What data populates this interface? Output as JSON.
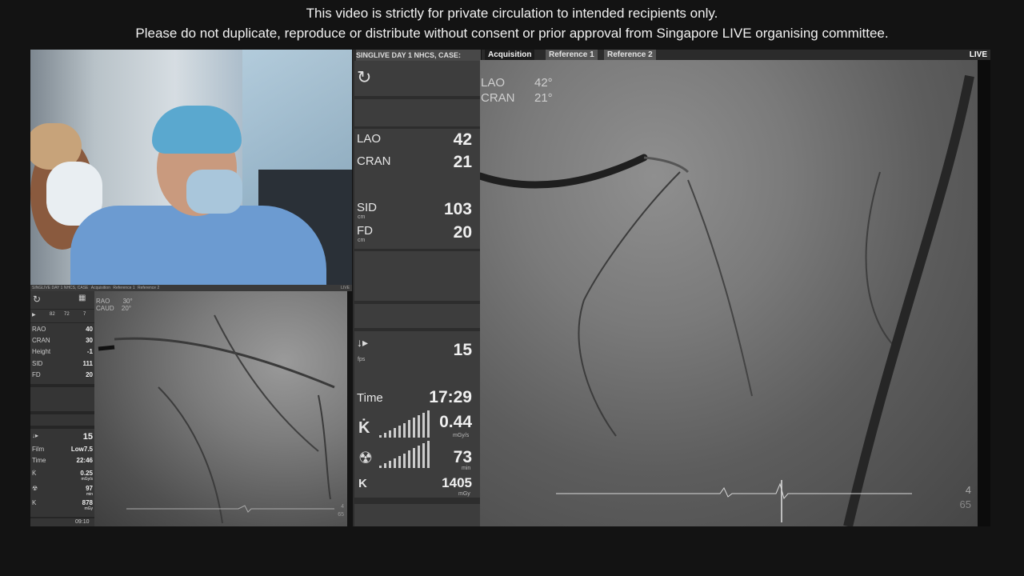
{
  "notice": {
    "line1": "This video is strictly for private circulation to intended recipients only.",
    "line2": "Please do not duplicate, reproduce or distribute without consent or prior approval from Singapore LIVE organising committee."
  },
  "small_panel": {
    "title": "SINGLIVE DAY 1 NHCS, CASE",
    "tabs": [
      "Acquisition",
      "Reference 1",
      "Reference 2"
    ],
    "live": "LIVE",
    "angle_overlay": {
      "rao": "RAO",
      "rao_val": "30°",
      "caud": "CAUD",
      "caud_val": "20°"
    },
    "readouts": [
      {
        "label": "RAO",
        "value": "40"
      },
      {
        "label": "CRAN",
        "value": "30"
      },
      {
        "label": "Height",
        "value": "-1"
      },
      {
        "label": "SID",
        "value": "111"
      },
      {
        "label": "FD",
        "value": "20"
      }
    ],
    "top_icons": [
      "82",
      "72",
      "7"
    ],
    "fps": "15",
    "film_label": "Film",
    "film_value": "Low7.5",
    "time_label": "Time",
    "time_value": "22:46",
    "dose_rate": "0.25",
    "dose_rate_unit": "mGy/s",
    "fluoro": "97",
    "fluoro_unit": "min",
    "k_label": "K",
    "k_value": "878",
    "k_unit": "mGy",
    "clock": "09:10",
    "frame_num": "4",
    "frame_total": "65"
  },
  "center_panel": {
    "title": "SINGLIVE DAY 1 NHCS, CASE:",
    "lao_label": "LAO",
    "lao_value": "42",
    "cran_label": "CRAN",
    "cran_value": "21",
    "sid_label": "SID",
    "sid_unit": "cm",
    "sid_value": "103",
    "fd_label": "FD",
    "fd_unit": "cm",
    "fd_value": "20",
    "fps_value": "15",
    "fps_unit": "fps",
    "time_label": "Time",
    "time_value": "17:29",
    "kdot_label": "K̇",
    "kdot_value": "0.44",
    "kdot_unit": "mGy/s",
    "fluoro_value": "73",
    "fluoro_unit": "min",
    "k_label": "K",
    "k_value": "1405",
    "k_unit": "mGy"
  },
  "main_view": {
    "tabs": [
      "Acquisition",
      "Reference 1",
      "Reference 2"
    ],
    "live": "LIVE",
    "lao_label": "LAO",
    "lao_value": "42°",
    "cran_label": "CRAN",
    "cran_value": "21°",
    "frame_num": "4",
    "frame_total": "65"
  }
}
